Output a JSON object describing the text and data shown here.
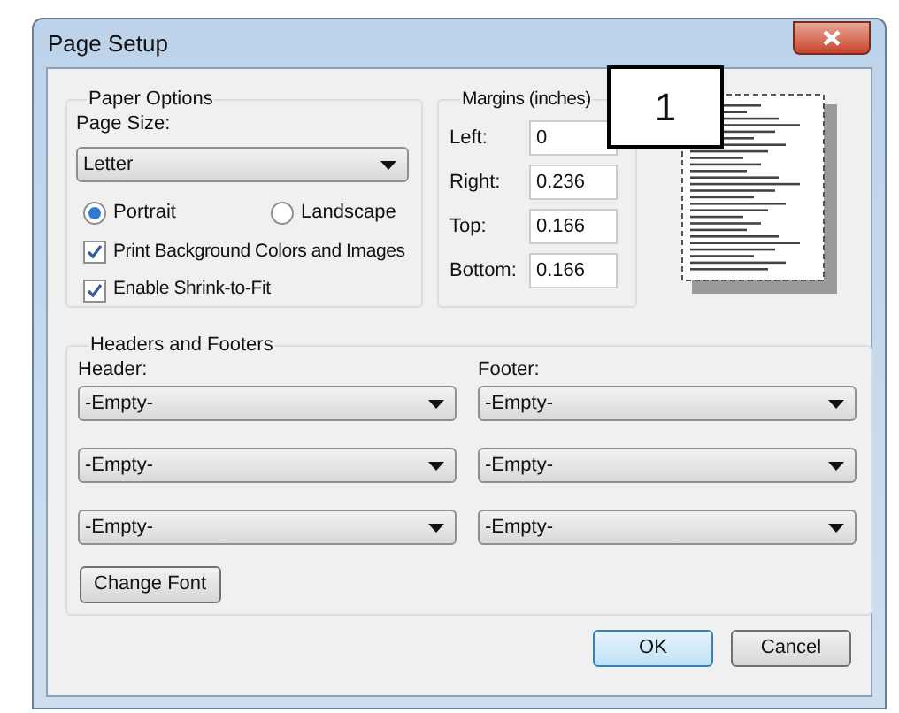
{
  "window": {
    "title": "Page Setup"
  },
  "paper_options": {
    "title": "Paper Options",
    "page_size_label": "Page Size:",
    "page_size": "Letter",
    "orientation": [
      {
        "label": "Portrait",
        "selected": true
      },
      {
        "label": "Landscape",
        "selected": false
      }
    ],
    "checkboxes": [
      {
        "label": "Print Background Colors and Images",
        "checked": true
      },
      {
        "label": "Enable Shrink-to-Fit",
        "checked": true
      }
    ]
  },
  "margins": {
    "title": "Margins (inches)",
    "fields": [
      {
        "label": "Left:",
        "value": "0"
      },
      {
        "label": "Right:",
        "value": "0.236"
      },
      {
        "label": "Top:",
        "value": "0.166"
      },
      {
        "label": "Bottom:",
        "value": "0.166"
      }
    ]
  },
  "callout": {
    "text": "1"
  },
  "headers_footers": {
    "title": "Headers and Footers",
    "header_label": "Header:",
    "footer_label": "Footer:",
    "headers": [
      "-Empty-",
      "-Empty-",
      "-Empty-"
    ],
    "footers": [
      "-Empty-",
      "-Empty-",
      "-Empty-"
    ],
    "change_font": "Change Font"
  },
  "buttons": [
    {
      "label": "OK",
      "default": true
    },
    {
      "label": "Cancel",
      "default": false
    }
  ]
}
